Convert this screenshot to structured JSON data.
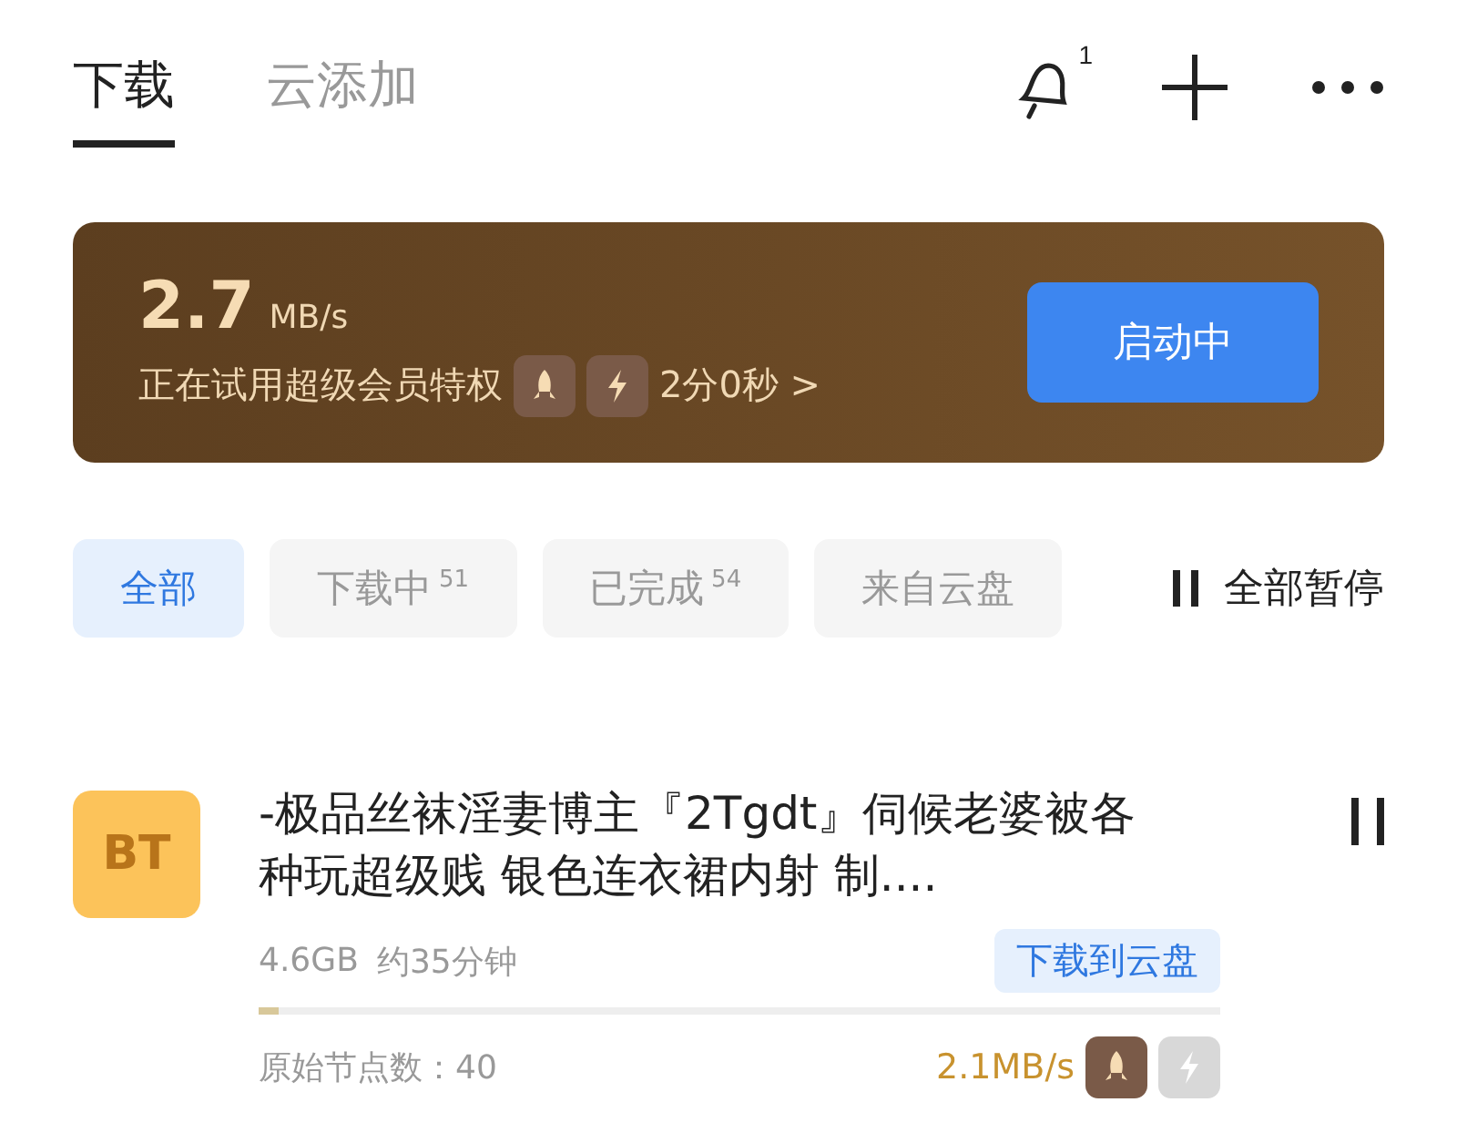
{
  "tabs": [
    {
      "label": "下载",
      "selected": true
    },
    {
      "label": "云添加",
      "selected": false
    }
  ],
  "header_actions": {
    "notification_badge": "1"
  },
  "speed_banner": {
    "speed": "2.7",
    "unit": "MB/s",
    "message": "正在试用超级会员特权",
    "timer": "2分0秒 >",
    "button": "启动中"
  },
  "filters": [
    {
      "label": "全部",
      "selected": true
    },
    {
      "label": "下载中",
      "count": "51",
      "selected": false
    },
    {
      "label": "已完成",
      "count": "54",
      "selected": false
    },
    {
      "label": "来自云盘",
      "selected": false
    }
  ],
  "pause_all": "全部暂停",
  "downloads": [
    {
      "type_label": "BT",
      "title": "-极品丝袜淫妻博主『2Tgdt』伺候老婆被各种玩超级贱 银色连衣裙内射 制....",
      "size": "4.6GB",
      "eta": "约35分钟",
      "cloud_button": "下载到云盘",
      "level": 0.02,
      "nodes": "原始节点数：40",
      "speed": "2.1MB/s",
      "boosts": [
        {
          "kind": "rocket",
          "active": true
        },
        {
          "kind": "bolt",
          "active": false
        }
      ]
    }
  ]
}
